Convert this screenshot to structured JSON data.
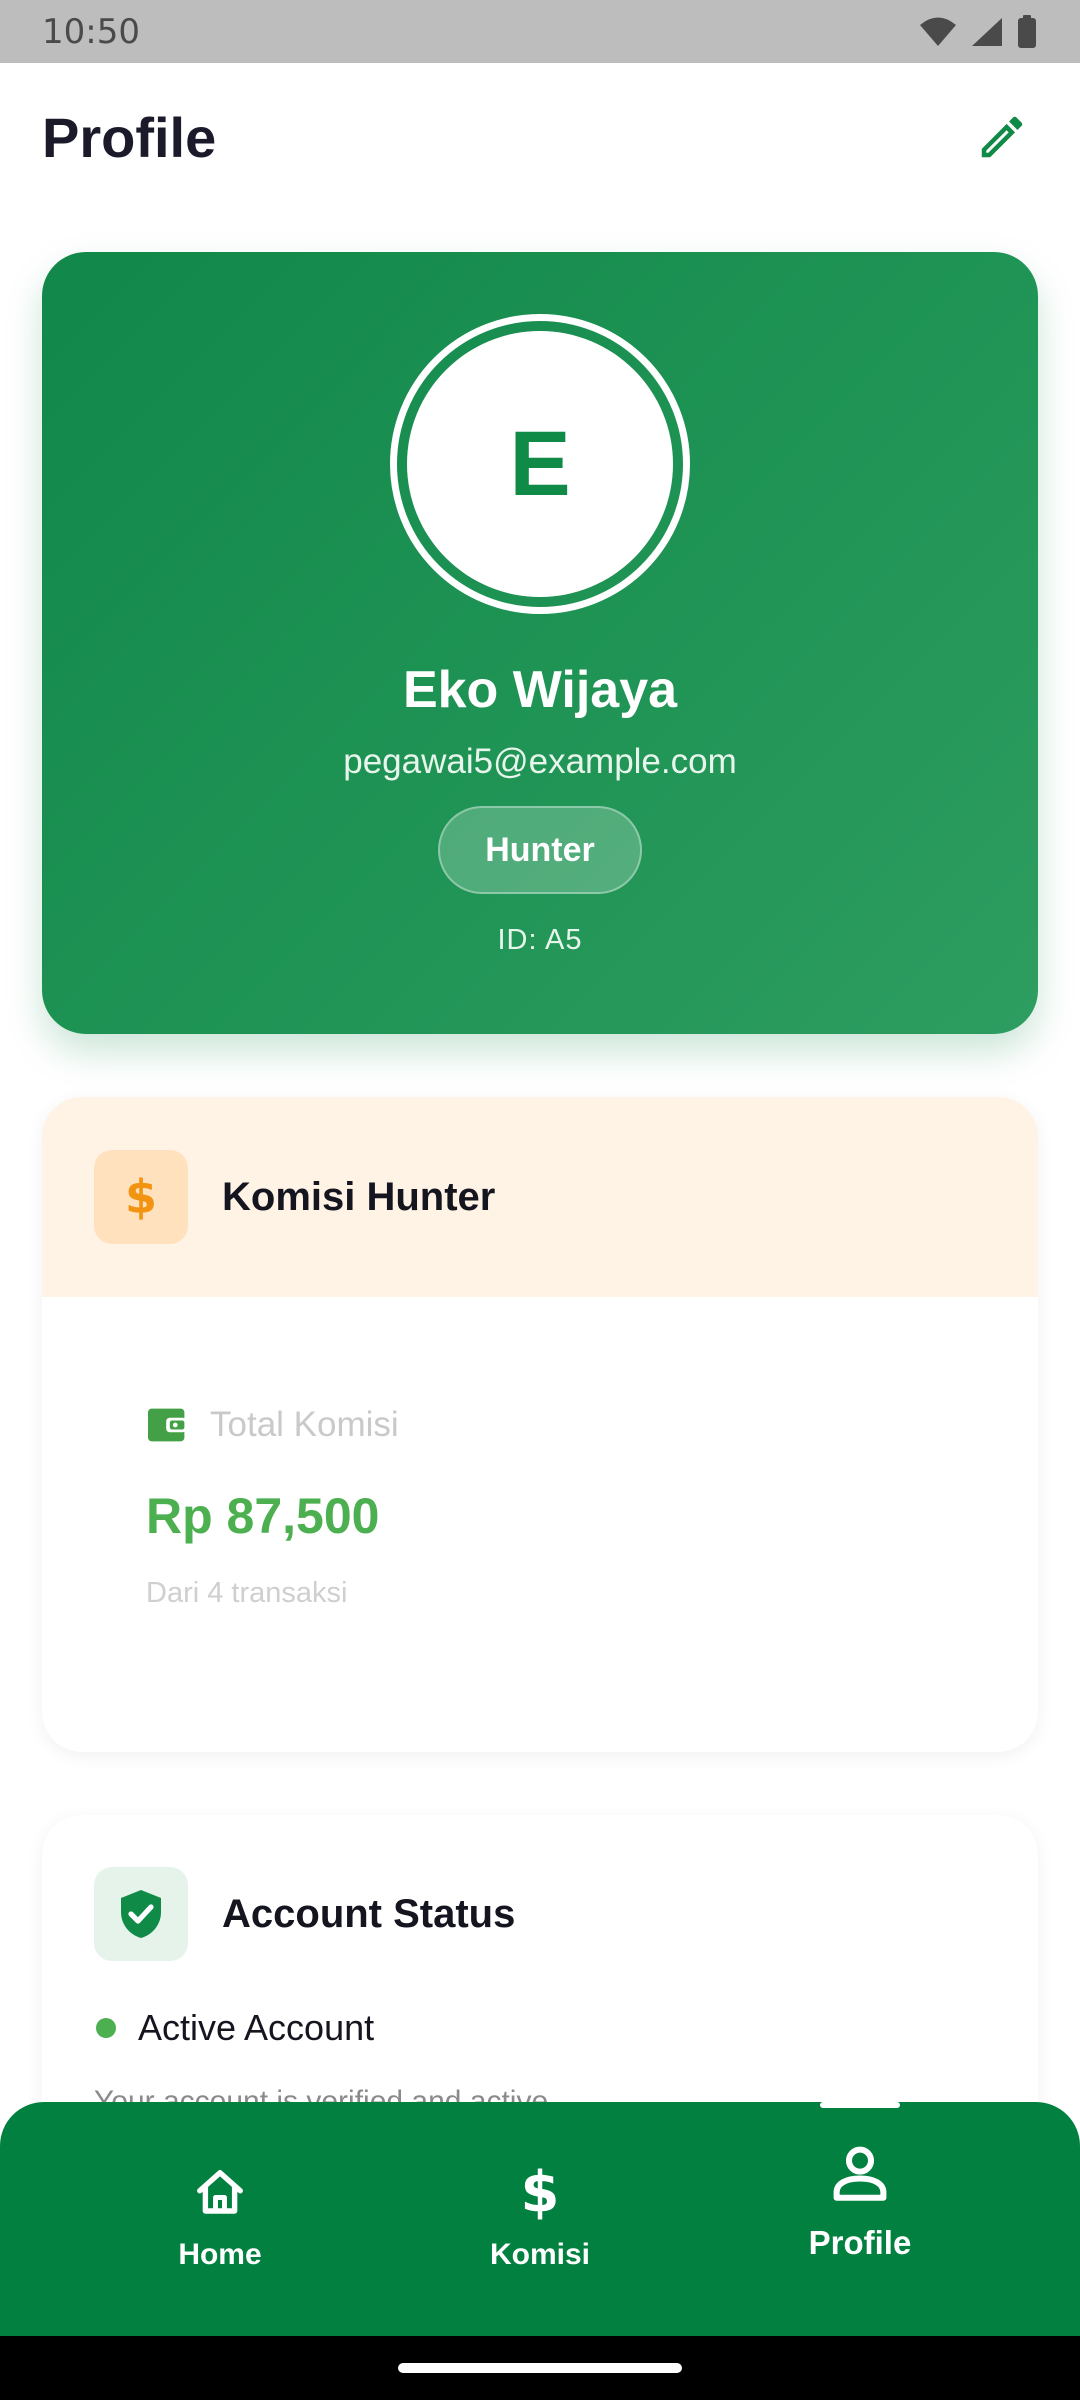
{
  "status_bar": {
    "time": "10:50",
    "icons": [
      "wifi-icon",
      "signal-icon",
      "battery-icon"
    ]
  },
  "header": {
    "title": "Profile",
    "edit_icon": "pencil-icon"
  },
  "profile": {
    "avatar_initial": "E",
    "name": "Eko Wijaya",
    "email": "pegawai5@example.com",
    "role": "Hunter",
    "id_text": "ID: A5"
  },
  "commission": {
    "icon": "dollar-icon",
    "icon_glyph": "$",
    "title": "Komisi Hunter",
    "total_icon": "wallet-icon",
    "total_label": "Total Komisi",
    "total_amount": "Rp 87,500",
    "subtitle": "Dari 4 transaksi"
  },
  "account_status": {
    "icon": "shield-check-icon",
    "title": "Account Status",
    "active_label": "Active Account",
    "description": "Your account is verified and active"
  },
  "bottom_nav": {
    "items": [
      {
        "label": "Home",
        "icon": "home-icon",
        "active": false
      },
      {
        "label": "Komisi",
        "icon": "dollar-icon",
        "glyph": "$",
        "active": false
      },
      {
        "label": "Profile",
        "icon": "person-icon",
        "active": true
      }
    ]
  },
  "colors": {
    "primary_green": "#018040",
    "card_green": "#1a8f50",
    "accent_orange": "#f29412",
    "amount_green": "#4caf50",
    "commission_header_bg": "#fff3e6"
  }
}
